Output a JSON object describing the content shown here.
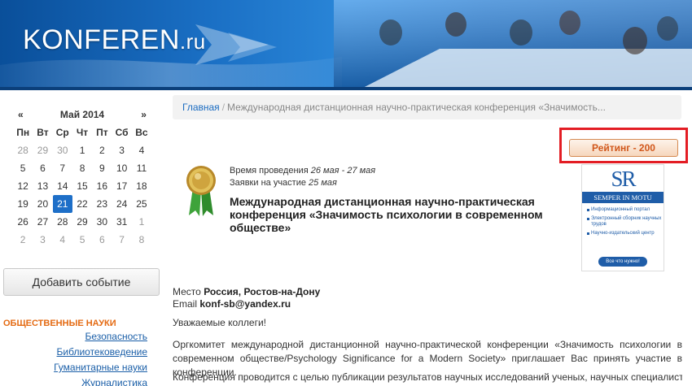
{
  "header": {
    "logo_main": "KONFEREN",
    "logo_tld": ".ru",
    "colors": {
      "primary": "#1a6fc4",
      "dark": "#0a4f9a"
    }
  },
  "calendar": {
    "prev_label": "«",
    "next_label": "»",
    "month_label": "Май 2014",
    "day_names": [
      "Пн",
      "Вт",
      "Ср",
      "Чт",
      "Пт",
      "Сб",
      "Вс"
    ],
    "weeks": [
      [
        "28",
        "29",
        "30",
        "1",
        "2",
        "3",
        "4"
      ],
      [
        "5",
        "6",
        "7",
        "8",
        "9",
        "10",
        "11"
      ],
      [
        "12",
        "13",
        "14",
        "15",
        "16",
        "17",
        "18"
      ],
      [
        "19",
        "20",
        "21",
        "22",
        "23",
        "24",
        "25"
      ],
      [
        "26",
        "27",
        "28",
        "29",
        "30",
        "31",
        "1"
      ],
      [
        "2",
        "3",
        "4",
        "5",
        "6",
        "7",
        "8"
      ]
    ],
    "selected_day": "21"
  },
  "sidebar": {
    "add_event_label": "Добавить событие",
    "category_title": "ОБЩЕСТВЕННЫЕ НАУКИ",
    "links": [
      "Безопасность",
      "Библиотековедение",
      "Гуманитарные науки",
      "Журналистика"
    ]
  },
  "breadcrumb": {
    "home": "Главная",
    "separator": "/",
    "current": "Международная дистанционная научно-практическая конференция «Значимость..."
  },
  "rating": {
    "label": "Рейтинг - 200",
    "highlight_color": "#e31d24"
  },
  "event": {
    "time_label": "Время проведения",
    "time_value": "26 мая - 27 мая",
    "apps_label": "Заявки на участие",
    "apps_value": "25 мая",
    "title": "Международная дистанционная научно-практическая конференция «Значимость психологии в современном обществе»",
    "place_label": "Место",
    "place_value": "Россия, Ростов-на-Дону",
    "email_label": "Email",
    "email_value": "konf-sb@yandex.ru"
  },
  "ad": {
    "logo": "SR",
    "band": "SEMPER IN MOTU",
    "items": [
      "Информационный портал",
      "Электронный сборник научных трудов",
      "Научно-издательский центр"
    ],
    "pill": "Все что нужно!"
  },
  "content": {
    "greeting": "Уважаемые коллеги!",
    "para1": "Оргкомитет международной дистанционной научно-практической конференции «Значимость психологии в современном обществе/Psychology Significance for a Modern Society» приглашает Вас принять участие в конференции.",
    "para2": "Конференция проводится с целью публикации результатов научных исследований ученых, научных специалистов по"
  }
}
